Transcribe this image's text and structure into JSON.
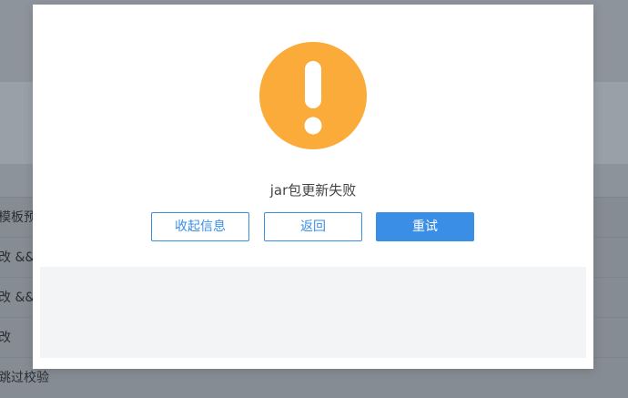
{
  "background": {
    "rows": [
      "模板预",
      "改 &&",
      "改 &&",
      "改",
      "跳过校验"
    ]
  },
  "dialog": {
    "icon": "exclamation-warning-icon",
    "icon_color": "#fbab39",
    "message": "jar包更新失败",
    "buttons": {
      "collapse_label": "收起信息",
      "back_label": "返回",
      "retry_label": "重试"
    },
    "accent_color": "#3a8ee6"
  }
}
